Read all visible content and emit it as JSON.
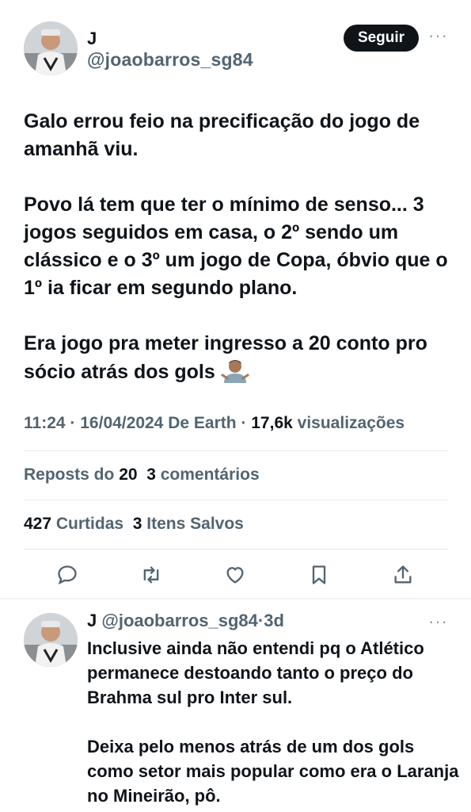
{
  "tweet": {
    "author_name": "J",
    "author_handle": "@joaobarros_sg84",
    "follow_label": "Seguir",
    "more_label": "···",
    "paragraphs": [
      "Galo errou feio na precificação do jogo de amanhã viu.",
      "Povo lá tem que ter o mínimo de senso... 3 jogos seguidos em casa, o 2º sendo um clássico e o 3º um jogo de Copa, óbvio que o 1º ia ficar em segundo plano.",
      "Era jogo pra meter ingresso a 20 conto pro sócio atrás dos gols"
    ],
    "emoji": "person-shrugging-emoji",
    "time": "11:24",
    "date": "16/04/2024",
    "source": "De Earth",
    "views_count": "17,6k",
    "views_label": "visualizações",
    "sep": "·"
  },
  "stats": {
    "reposts_label": "Reposts do",
    "reposts_count": "20",
    "comments_count": "3",
    "comments_label": "comentários",
    "likes_count": "427",
    "likes_label": "Curtidas",
    "saved_count": "3",
    "saved_label": "Itens Salvos"
  },
  "actions": [
    {
      "name": "reply-icon"
    },
    {
      "name": "retweet-icon"
    },
    {
      "name": "like-icon"
    },
    {
      "name": "bookmark-icon"
    },
    {
      "name": "share-icon"
    }
  ],
  "reply": {
    "author_name": "J",
    "author_handle": "@joaobarros_sg84",
    "sep": "·",
    "time_ago": "3d",
    "paragraphs": [
      "Inclusive ainda não entendi pq o Atlético permanece destoando tanto o preço do Brahma sul pro Inter sul.",
      "Deixa pelo menos atrás de um dos gols como setor mais popular como era o Laranja no Mineirão, pô."
    ]
  },
  "colors": {
    "text": "#0f1419",
    "secondary": "#536471",
    "divider": "#eff3f4",
    "button": "#0f1419"
  }
}
